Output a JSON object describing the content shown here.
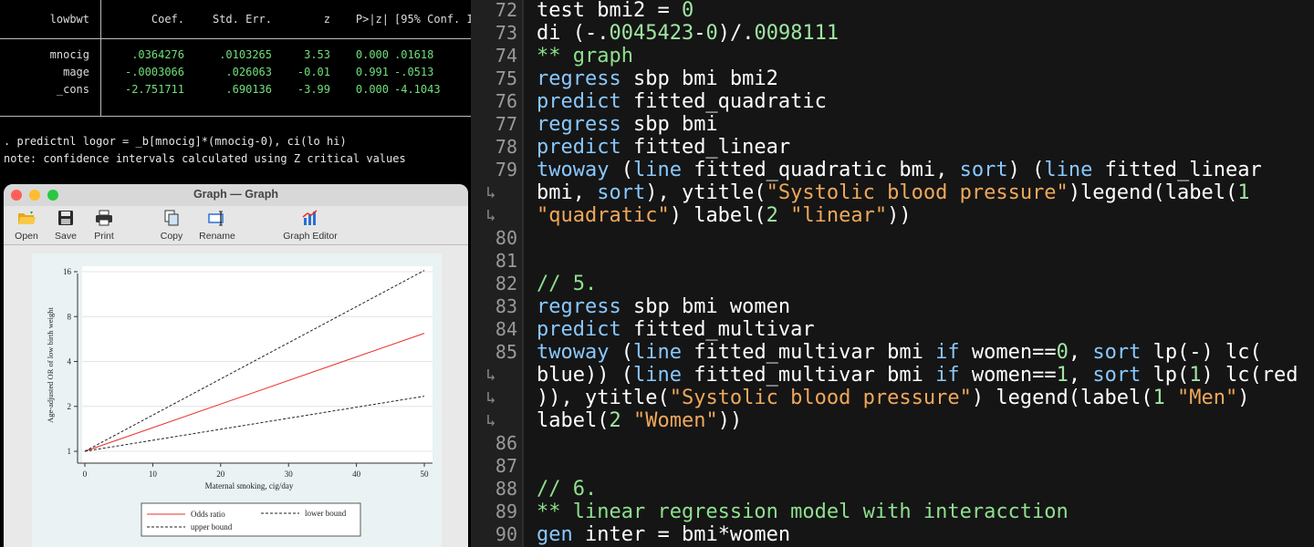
{
  "console": {
    "table_header": [
      "lowbwt",
      "Coef.",
      "Std. Err.",
      "z",
      "P>|z|",
      "[95% Conf. Interval]"
    ],
    "rows": [
      {
        "name": "mnocig",
        "coef": ".0364276",
        "se": ".0103265",
        "z": "3.53",
        "p": "0.000",
        "ci": ".01618"
      },
      {
        "name": "mage",
        "coef": "-.0003066",
        "se": ".026063",
        "z": "-0.01",
        "p": "0.991",
        "ci": "-.0513"
      },
      {
        "name": "_cons",
        "coef": "-2.751711",
        "se": ".690136",
        "z": "-3.99",
        "p": "0.000",
        "ci": "-4.1043"
      }
    ],
    "command": ". predictnl logor = _b[mnocig]*(mnocig-0), ci(lo hi)",
    "note": "note: confidence intervals calculated using Z critical values"
  },
  "graph_window": {
    "title": "Graph — Graph",
    "toolbar": {
      "open": "Open",
      "save": "Save",
      "print": "Print",
      "copy": "Copy",
      "rename": "Rename",
      "graph_editor": "Graph Editor"
    },
    "colors": {
      "close": "#ff5f57",
      "minimize": "#febc2e",
      "zoom": "#28c840"
    }
  },
  "chart_data": {
    "type": "line",
    "xlabel": "Maternal smoking, cig/day",
    "ylabel": "Age-adjusted OR of low birth weight",
    "y_scale": "log",
    "x_ticks": [
      0,
      10,
      20,
      30,
      40,
      50
    ],
    "y_ticks": [
      1,
      2,
      4,
      8,
      16
    ],
    "xlim": [
      0,
      50
    ],
    "ylim": [
      1,
      16
    ],
    "x": [
      0,
      50
    ],
    "series": [
      {
        "name": "Odds ratio",
        "values": [
          1,
          6.18
        ],
        "color": "#e8302a",
        "style": "solid"
      },
      {
        "name": "lower bound",
        "values": [
          1,
          2.34
        ],
        "color": "#222222",
        "style": "dashed"
      },
      {
        "name": "upper bound",
        "values": [
          1,
          16.3
        ],
        "color": "#222222",
        "style": "dashed"
      }
    ],
    "legend_position": "bottom",
    "grid": "horizontal"
  },
  "editor": {
    "lines": [
      {
        "n": "72",
        "segs": [
          [
            "plain",
            "test bmi2 = "
          ],
          [
            "num",
            "0"
          ]
        ]
      },
      {
        "n": "73",
        "segs": [
          [
            "plain",
            "di (-."
          ],
          [
            "num",
            "0045423"
          ],
          [
            "plain",
            "-"
          ],
          [
            "num",
            "0"
          ],
          [
            "plain",
            ")/."
          ],
          [
            "num",
            "0098111"
          ]
        ]
      },
      {
        "n": "74",
        "segs": [
          [
            "cmt",
            "** graph"
          ]
        ]
      },
      {
        "n": "75",
        "segs": [
          [
            "kw",
            "regress"
          ],
          [
            "plain",
            " sbp bmi bmi2"
          ]
        ]
      },
      {
        "n": "76",
        "segs": [
          [
            "kw",
            "predict"
          ],
          [
            "plain",
            " fitted_quadratic"
          ]
        ]
      },
      {
        "n": "77",
        "segs": [
          [
            "kw",
            "regress"
          ],
          [
            "plain",
            " sbp bmi"
          ]
        ]
      },
      {
        "n": "78",
        "segs": [
          [
            "kw",
            "predict"
          ],
          [
            "plain",
            " fitted_linear"
          ]
        ]
      },
      {
        "n": "79",
        "segs": [
          [
            "kw",
            "twoway"
          ],
          [
            "plain",
            " ("
          ],
          [
            "kw",
            "line"
          ],
          [
            "plain",
            " fitted_quadratic bmi, "
          ],
          [
            "kw",
            "sort"
          ],
          [
            "plain",
            ") ("
          ],
          [
            "kw",
            "line"
          ],
          [
            "plain",
            " fitted_linear"
          ]
        ]
      },
      {
        "n": "wrap",
        "segs": [
          [
            "plain",
            "bmi, "
          ],
          [
            "kw",
            "sort"
          ],
          [
            "plain",
            "), ytitle("
          ],
          [
            "str",
            "\"Systolic blood pressure\""
          ],
          [
            "plain",
            ")legend(label("
          ],
          [
            "num",
            "1"
          ]
        ]
      },
      {
        "n": "wrap",
        "segs": [
          [
            "str",
            "\"quadratic\""
          ],
          [
            "plain",
            ") label("
          ],
          [
            "num",
            "2"
          ],
          [
            "plain",
            " "
          ],
          [
            "str",
            "\"linear\""
          ],
          [
            "plain",
            "))"
          ]
        ]
      },
      {
        "n": "80",
        "segs": []
      },
      {
        "n": "81",
        "segs": []
      },
      {
        "n": "82",
        "segs": [
          [
            "cmt",
            "// 5."
          ]
        ]
      },
      {
        "n": "83",
        "segs": [
          [
            "kw",
            "regress"
          ],
          [
            "plain",
            " sbp bmi women"
          ]
        ]
      },
      {
        "n": "84",
        "segs": [
          [
            "kw",
            "predict"
          ],
          [
            "plain",
            " fitted_multivar"
          ]
        ]
      },
      {
        "n": "85",
        "segs": [
          [
            "kw",
            "twoway"
          ],
          [
            "plain",
            " ("
          ],
          [
            "kw",
            "line"
          ],
          [
            "plain",
            " fitted_multivar bmi "
          ],
          [
            "kw",
            "if"
          ],
          [
            "plain",
            " women=="
          ],
          [
            "num",
            "0"
          ],
          [
            "plain",
            ", "
          ],
          [
            "kw",
            "sort"
          ],
          [
            "plain",
            " lp(-) lc("
          ]
        ]
      },
      {
        "n": "wrap",
        "segs": [
          [
            "plain",
            "blue)) ("
          ],
          [
            "kw",
            "line"
          ],
          [
            "plain",
            " fitted_multivar bmi "
          ],
          [
            "kw",
            "if"
          ],
          [
            "plain",
            " women=="
          ],
          [
            "num",
            "1"
          ],
          [
            "plain",
            ", "
          ],
          [
            "kw",
            "sort"
          ],
          [
            "plain",
            " lp("
          ],
          [
            "num",
            "1"
          ],
          [
            "plain",
            ") lc(red"
          ]
        ]
      },
      {
        "n": "wrap",
        "segs": [
          [
            "plain",
            ")), ytitle("
          ],
          [
            "str",
            "\"Systolic blood pressure\""
          ],
          [
            "plain",
            ") legend(label("
          ],
          [
            "num",
            "1"
          ],
          [
            "plain",
            " "
          ],
          [
            "str",
            "\"Men\""
          ],
          [
            "plain",
            ")"
          ]
        ]
      },
      {
        "n": "wrap",
        "segs": [
          [
            "plain",
            "label("
          ],
          [
            "num",
            "2"
          ],
          [
            "plain",
            " "
          ],
          [
            "str",
            "\"Women\""
          ],
          [
            "plain",
            "))"
          ]
        ]
      },
      {
        "n": "86",
        "segs": []
      },
      {
        "n": "87",
        "segs": []
      },
      {
        "n": "88",
        "segs": [
          [
            "cmt",
            "// 6."
          ]
        ]
      },
      {
        "n": "89",
        "segs": [
          [
            "cmt",
            "** linear regression model with interacction"
          ]
        ]
      },
      {
        "n": "90",
        "segs": [
          [
            "kw",
            "gen"
          ],
          [
            "plain",
            " inter = bmi*women"
          ]
        ]
      }
    ]
  }
}
